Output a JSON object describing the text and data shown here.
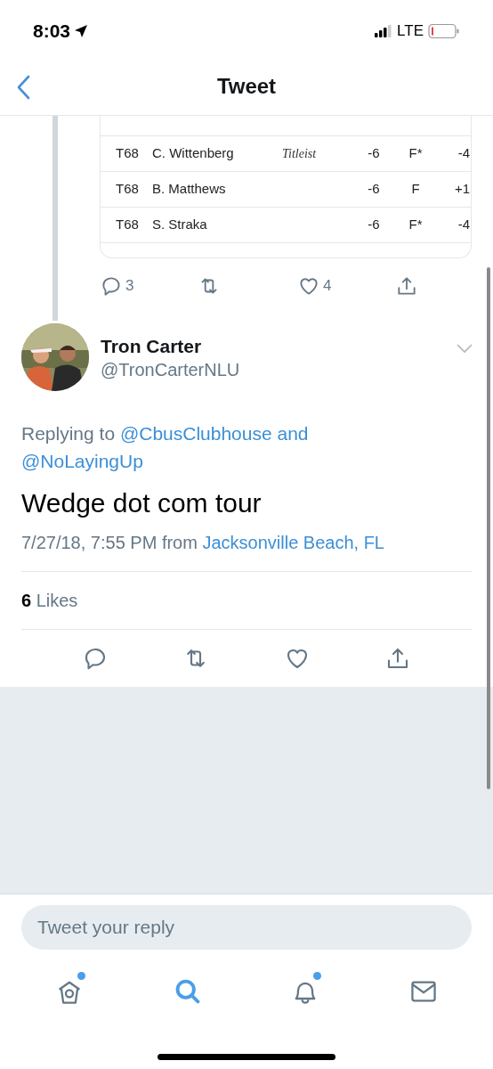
{
  "status_bar": {
    "time": "8:03",
    "network": "LTE"
  },
  "nav": {
    "title": "Tweet"
  },
  "quoted_table": {
    "rows": [
      {
        "position": "T68",
        "player": "C. Wittenberg",
        "sponsor": "Titleist",
        "to_par": "-6",
        "thru": "F*",
        "today": "-4"
      },
      {
        "position": "T68",
        "player": "B. Matthews",
        "to_par": "-6",
        "thru": "F",
        "today": "+1"
      },
      {
        "position": "T68",
        "player": "S. Straka",
        "to_par": "-6",
        "thru": "F*",
        "today": "-4"
      }
    ]
  },
  "parent_actions": [
    {
      "kind": "reply",
      "count": "3"
    },
    {
      "kind": "retweet"
    },
    {
      "kind": "like",
      "count": "4"
    },
    {
      "kind": "share"
    }
  ],
  "tweet": {
    "author_name": "Tron Carter",
    "handle": "@TronCarterNLU",
    "replying": {
      "prefix": "Replying to",
      "mentions": [
        "@CbusClubhouse",
        "@NoLayingUp"
      ],
      "joiner": "and"
    },
    "text": "Wedge dot com tour",
    "timestamp": "7/27/18, 7:55 PM",
    "source_prefix": "from",
    "location": "Jacksonville Beach, FL",
    "likes": {
      "count": "6",
      "label": "Likes"
    }
  },
  "actions": [
    {
      "kind": "reply"
    },
    {
      "kind": "retweet"
    },
    {
      "kind": "like"
    },
    {
      "kind": "share"
    }
  ],
  "reply_field": {
    "placeholder": "Tweet your reply"
  },
  "tab_bar": [
    {
      "kind": "home",
      "selected": false,
      "badge": true
    },
    {
      "kind": "search",
      "selected": true,
      "badge": false
    },
    {
      "kind": "notifications",
      "selected": false,
      "badge": true
    },
    {
      "kind": "messages",
      "selected": false,
      "badge": false
    }
  ]
}
